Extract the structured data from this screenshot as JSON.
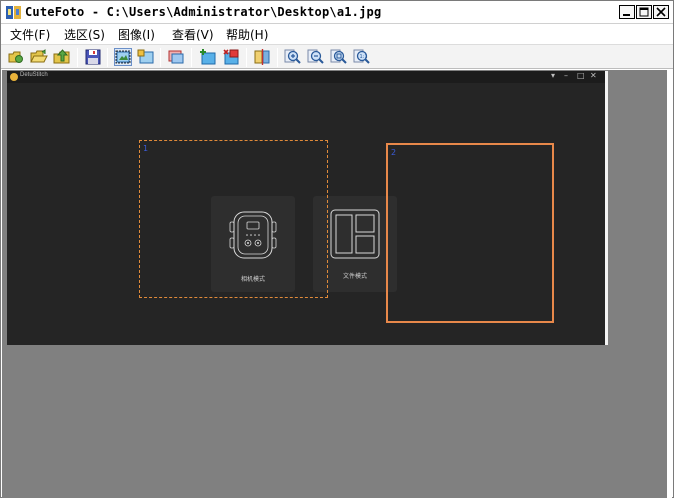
{
  "window": {
    "title": "CuteFoto - C:\\Users\\Administrator\\Desktop\\a1.jpg",
    "controls": {
      "minimize": "minimize",
      "maximize": "maximize",
      "close": "close"
    }
  },
  "menubar": {
    "items": [
      {
        "label": "文件(F)"
      },
      {
        "label": "选区(S)"
      },
      {
        "label": "图像(I)"
      },
      {
        "label": "查看(V)"
      },
      {
        "label": "帮助(H)"
      }
    ]
  },
  "toolbar": {
    "buttons": [
      {
        "icon": "new-icon"
      },
      {
        "icon": "open-folder-icon"
      },
      {
        "icon": "up-folder-icon"
      },
      {
        "icon": "save-icon"
      },
      {
        "icon": "select-region-icon",
        "active": true
      },
      {
        "icon": "image-icon"
      },
      {
        "icon": "crop-icon"
      },
      {
        "icon": "add-selection-icon"
      },
      {
        "icon": "delete-selection-icon"
      },
      {
        "icon": "split-icon"
      },
      {
        "icon": "zoom-in-icon"
      },
      {
        "icon": "zoom-out-icon"
      },
      {
        "icon": "zoom-fit-icon"
      },
      {
        "icon": "zoom-actual-icon"
      }
    ]
  },
  "image_content": {
    "app_name": "DetuStitch",
    "window_controls": [
      "▾",
      "–",
      "□",
      "✕"
    ],
    "modes": [
      {
        "label": "相机模式",
        "icon": "camera-icon"
      },
      {
        "label": "文件模式",
        "icon": "file-layout-icon"
      }
    ],
    "selections": [
      {
        "style": "dashed",
        "marker": "1"
      },
      {
        "style": "solid",
        "marker": "2"
      }
    ]
  },
  "colors": {
    "selection_dashed": "#e08a3a",
    "selection_solid": "#e8884a",
    "image_background": "#252525",
    "canvas_background": "#808080"
  }
}
